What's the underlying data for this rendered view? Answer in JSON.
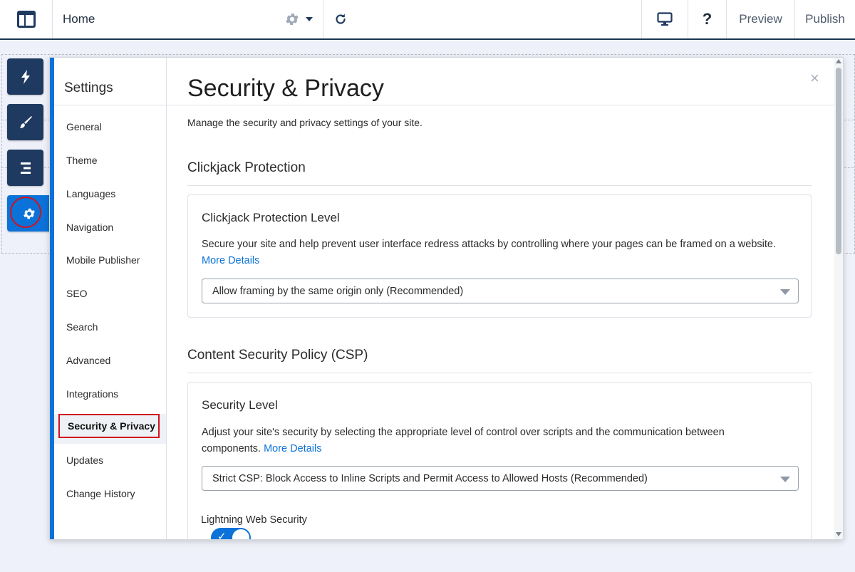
{
  "topbar": {
    "title": "Home",
    "preview_label": "Preview",
    "publish_label": "Publish",
    "help_label": "?",
    "icons": {
      "logo": "layout-icon",
      "page_settings": "gear-icon",
      "dropdown": "caret-down-icon",
      "undo": "refresh-icon",
      "device": "monitor-icon"
    }
  },
  "rail": {
    "items": [
      {
        "icon": "lightning-icon"
      },
      {
        "icon": "brush-icon"
      },
      {
        "icon": "list-icon"
      },
      {
        "icon": "settings-icon",
        "active": true
      }
    ]
  },
  "settings": {
    "title": "Settings",
    "nav": [
      {
        "label": "General"
      },
      {
        "label": "Theme"
      },
      {
        "label": "Languages"
      },
      {
        "label": "Navigation"
      },
      {
        "label": "Mobile Publisher"
      },
      {
        "label": "SEO"
      },
      {
        "label": "Search"
      },
      {
        "label": "Advanced"
      },
      {
        "label": "Integrations"
      },
      {
        "label": "Security & Privacy",
        "selected": true
      },
      {
        "label": "Updates"
      },
      {
        "label": "Change History"
      }
    ]
  },
  "main": {
    "title": "Security & Privacy",
    "close_label": "×",
    "description": "Manage the security and privacy settings of your site.",
    "clickjack": {
      "section_title": "Clickjack Protection",
      "card_title": "Clickjack Protection Level",
      "text": "Secure your site and help prevent user interface redress attacks by controlling where your pages can be framed on a website.",
      "link": "More Details",
      "selected_option": "Allow framing by the same origin only (Recommended)"
    },
    "csp": {
      "section_title": "Content Security Policy (CSP)",
      "card_title": "Security Level",
      "text": "Adjust your site's security by selecting the appropriate level of control over scripts and the communication between components.",
      "link": "More Details",
      "selected_option": "Strict CSP: Block Access to Inline Scripts and Permit Access to Allowed Hosts (Recommended)",
      "lws_label": "Lightning Web Security",
      "lws_enabled": true
    }
  },
  "colors": {
    "accent": "#0b72d9",
    "rail": "#1f3a60",
    "highlight": "#d0121b"
  }
}
